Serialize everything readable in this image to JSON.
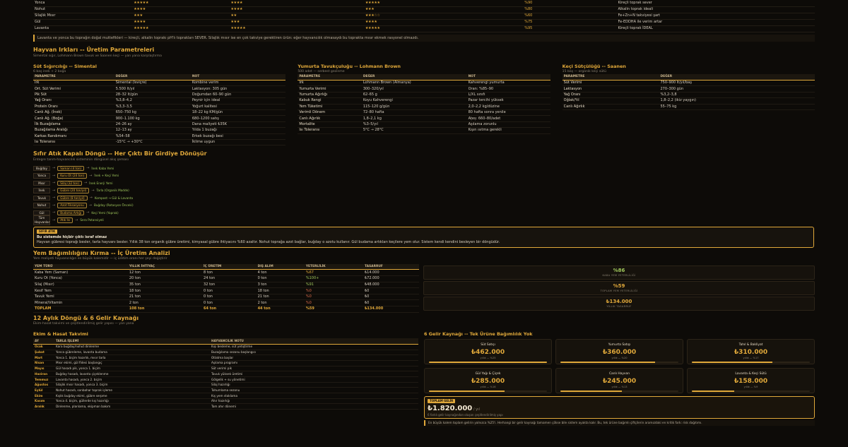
{
  "soil_rows": [
    {
      "name": "Yonca",
      "s1": "★★★★★",
      "s2": "★★★★",
      "s3": "★★★★★",
      "pct": "%90",
      "note": "Kireçli toprak sever"
    },
    {
      "name": "Nohut",
      "s1": "★★★★",
      "s2": "★★★★",
      "s3": "★★★",
      "pct": "%80",
      "note": "Alkalin toprak ideali"
    },
    {
      "name": "Silajlık Mısır",
      "s1": "★★★",
      "s2": "★★",
      "s3": "★★★☆☆",
      "pct": "%60",
      "note": "Fe+Zn+N takviyesi şart"
    },
    {
      "name": "Gül",
      "s1": "★★★★",
      "s2": "★★★",
      "s3": "★★★★",
      "pct": "%75",
      "note": "Fe-EDDHA ile verim artar"
    },
    {
      "name": "Lavanta",
      "s1": "★★★★★",
      "s2": "★★★★★",
      "s3": "★★★★★",
      "pct": "%95",
      "note": "Kireçli toprak İDEAL"
    }
  ],
  "soil_note": "Lavanta ve yonca bu toprağın doğal muttefikleri — kireçli, alkalin toprakı pH'lı toprakları SEVER. Silajlık mısır ise en çok takviye gerektiren ürün: eğer hayvancılık olmasaydı bu toprakta mısır ekmek rasyonel olmazdı.",
  "livestock": {
    "title": "Hayvan Irkları -- Üretim Parametreleri",
    "subtitle": "Simental sığır, Lohmann Brown tavuk ve Saanen keçi — yan yana karşılaştırma",
    "headers": {
      "param": "PARAMETRE",
      "value": "DEĞER",
      "note": "NOT"
    },
    "dairy": {
      "title": "Süt Sığırcılığı -- Simental",
      "sub": "6 baş inek + 2 boğa",
      "rows": [
        [
          "Irk",
          "Simental (İsviçre)",
          "Kombine verim"
        ],
        [
          "Ort. Süt Verimi",
          "5.500 lt/yıl",
          "Laktasyon: 305 gün"
        ],
        [
          "Pik Süt",
          "28–32 lt/gün",
          "Doğumdan 60–90 gün"
        ],
        [
          "Yağ Oranı",
          "%3,8–4,2",
          "Peynir için ideal"
        ],
        [
          "Protein Oranı",
          "%3,3–3,5",
          "Yoğurt kalitesi"
        ],
        [
          "Canlı Ağ. (İnek)",
          "650–750 kg",
          "18–22 kg KM/gün"
        ],
        [
          "Canlı Ağ. (Boğa)",
          "900–1.100 kg",
          "680–1200 satış"
        ],
        [
          "İlk Buzağılama",
          "24–26 ay",
          "Dana maliyeti ₺35K"
        ],
        [
          "Buzağılama Aralığı",
          "12–13 ay",
          "Yılda 1 buzağı"
        ],
        [
          "Karkas Randımanı",
          "%54–58",
          "Erkek buzağı besi"
        ],
        [
          "Isı Toleransı",
          "-15°C → +30°C",
          "İklime uygun"
        ]
      ]
    },
    "poultry": {
      "title": "Yumurta Tavukçuluğu -- Lohmann Brown",
      "sub": "500 adet — serbest gezinme",
      "rows": [
        [
          "Irk",
          "Lohmann Brown (Almanya)",
          "Kahverengi yumurta"
        ],
        [
          "Yumurta Verimi",
          "300–320/yıl",
          "Oran: %85–90"
        ],
        [
          "Yumurta Ağırlığı",
          "62–65 g",
          "L/XL sınıfı"
        ],
        [
          "Kabuk Rengi",
          "Koyu Kahverengi",
          "Pazar tercihi yüksek"
        ],
        [
          "Yem Tüketimi",
          "115–120 g/gün",
          "2,0–2,2 kg/düzine"
        ],
        [
          "Verimli Dönem",
          "72–80 hafta",
          "80 hafta sonra yenile"
        ],
        [
          "Canlı Ağırlık",
          "1,8–2,1 kg",
          "Ațeș: 660–80/adet"
        ],
        [
          "Mortalite",
          "%3–5/yıl",
          "Aşılama zorunlu"
        ],
        [
          "Isı Toleransı",
          "5°C → 28°C",
          "Kışın ısıtma gerekli"
        ]
      ]
    },
    "goat": {
      "title": "Keçi Sütçülüğü -- Saanen",
      "sub": "15 baş — organik keçi sütü",
      "rows": [
        [
          "Süt Verimi",
          "750–900 lt/yıl/baş"
        ],
        [
          "Laktasyon",
          "270–300 gün"
        ],
        [
          "Yağ Oranı",
          "%3,2–3,8"
        ],
        [
          "Oğlak/Yıl",
          "1,8–2,2 (ikiz yaygın)"
        ],
        [
          "Canlı Ağırlık",
          "55–75 kg"
        ]
      ]
    }
  },
  "cycle": {
    "title": "Sıfır Atık Kapalı Döngü -- Her Çıktı Bir Girdiye Dönüşür",
    "subtitle": "Entegre tarım-hayvancılık sisteminin döngüsel akış şeması",
    "rows": [
      [
        "Buğday",
        "Saman (4 ton)",
        "İnek Kaba Yemi"
      ],
      [
        "Yonca",
        "Kuru Ot (24 ton)",
        "İnek + Keçi Yemi"
      ],
      [
        "Mısır",
        "Silaj (32 ton)",
        "İnek Enerji Yemi"
      ],
      [
        "İnek",
        "Gübre (20 ton/yıl)",
        "Tarla (Organik Madde)"
      ],
      [
        "Tavuk",
        "Gübre (8 ton/yıl)",
        "Kompost → Gül & Lavanta"
      ],
      [
        "Nohut",
        "Azot Fiksasyonu",
        "Buğday (Rotasyon Önceki)"
      ],
      [
        "Gül",
        "Budama Artığı",
        "Keçi Yemi (Yaprak)"
      ],
      [
        "Tüm Hayvanlar",
        "Atık Isı",
        "Sera Potansiyeli"
      ]
    ],
    "tag": "SIFIR ATIK",
    "zero_title": "Bu sistemde hiçbir çıktı israf olmaz",
    "zero_text": "Hayvan gübresi toprağı besler, tarla hayvanı besler. Yıllık 38 ton organik gübre üretimi, kimyasal gübre ihtiyacını %60 azaltır. Nohut toprağa azot bağlar, buğday o azotu kullanır. Gül budama artıkları keçilere yem olur. Sistem kendi kendini besleyen bir döngüdür."
  },
  "feed": {
    "title": "Yem Bağımlılığını Kırma -- İç Üretim Analizi",
    "subtitle": "Yem maliyeti hayvancılığın en büyük kalemidir — iç üretim oranı her şeyi değiştirir",
    "headers": [
      "YEM TÜRÜ",
      "YILLIK İHTİYAÇ",
      "İÇ ÜRETİM",
      "DIŞ ALIM",
      "YETERLİLİK",
      "TASARRUF"
    ],
    "rows": [
      {
        "c": [
          "Kaba Yem (Saman)",
          "12 ton",
          "8 ton",
          "4 ton",
          "%67",
          "₺14.000"
        ],
        "k": "mid"
      },
      {
        "c": [
          "Kuru Ot (Yonca)",
          "20 ton",
          "24 ton",
          "0 ton",
          "%100+",
          "₺72.000"
        ],
        "k": "good"
      },
      {
        "c": [
          "Silaj (Mısır)",
          "35 ton",
          "32 ton",
          "3 ton",
          "%91",
          "₺48.000"
        ],
        "k": "good"
      },
      {
        "c": [
          "Kesif Yem",
          "18 ton",
          "0 ton",
          "18 ton",
          "%0",
          "₺0"
        ],
        "k": "bad"
      },
      {
        "c": [
          "Tavuk Yemi",
          "21 ton",
          "0 ton",
          "21 ton",
          "%0",
          "₺0"
        ],
        "k": "bad"
      },
      {
        "c": [
          "Mineral/Vitamin",
          "2 ton",
          "0 ton",
          "2 ton",
          "%0",
          "₺0"
        ],
        "k": "bad"
      }
    ],
    "total": [
      "TOPLAM",
      "108 ton",
      "64 ton",
      "44 ton",
      "%59",
      "₺134.000"
    ],
    "kpis": [
      {
        "v": "%86",
        "l": "KABA YEM YETERLİLİĞİ",
        "c": "#9fc65c"
      },
      {
        "v": "%59",
        "l": "TOPLAM YEM YETERLİLİĞİ",
        "c": "#e0a83a"
      },
      {
        "v": "₺134.000",
        "l": "YILLIK TASARRUF",
        "c": "#e0a83a"
      }
    ]
  },
  "cycle12": {
    "title": "12 Aylık Döngü & 6 Gelir Kaynağı",
    "subtitle": "Ekim-hasat takvimi ve çeşitlendirilmiş gelir yapısı — yan yana",
    "cal_title": "Ekim & Hasat Takvimi",
    "cal_headers": [
      "AY",
      "TARLA İŞLEMİ",
      "HAYVANCILIK NOTU"
    ],
    "cal_rows": [
      [
        "Ocak",
        "Kara buğday/nohut dinlenme",
        "Kışı besleme, süt yetiştirme"
      ],
      [
        "Şubat",
        "Yonca gübreleme, lavanta budama",
        "Buzağılama sezonu başlangıcı"
      ],
      [
        "Mart",
        "Yonca 1. biçim hazırlık, mısır tarla",
        "Otlatma başlar"
      ],
      [
        "Nisan",
        "Mısır ekimi, gül fidesi başlangıç",
        "Aşılama programı"
      ],
      [
        "Mayıs",
        "Gül hasadı pik, yonca 1. biçim",
        "Süt verimi pik"
      ],
      [
        "Haziran",
        "Buğday hasadı, lavanta çiçeklenme",
        "Tavuk yüksek üretimi"
      ],
      [
        "Temmuz",
        "Lavanta hasadı, yonca 2. biçim",
        "Gölgelik + su yönetimi"
      ],
      [
        "Ağustos",
        "Silajlık mısır hasadı, yonca 3. biçim",
        "Silaj hazırlığı"
      ],
      [
        "Eylül",
        "Nohut hasadı, sonbahar toprak işleme",
        "Tohumlama sezonu"
      ],
      [
        "Ekim",
        "Kışlık buğday ekimi, gübre serpme",
        "Kış yem stoklama"
      ],
      [
        "Kasım",
        "Yonca 4. biçim, güllerde kış hazırlığı",
        "Ahır hazırlığı"
      ],
      [
        "Aralık",
        "Dinlenme, planlama, ekipman bakım",
        "Tam ahır dönemi"
      ]
    ],
    "income_title": "6 Gelir Kaynağı -- Tek Ürüne Bağımlılık Yok",
    "cards": [
      {
        "n": "Süt Satışı",
        "v": "₺462.000",
        "s": "yıllık — %25",
        "p": 25
      },
      {
        "n": "Yumurta Satışı",
        "v": "₺360.000",
        "s": "yıllık — %20",
        "p": 20
      },
      {
        "n": "Tahıl & Bakliyat",
        "v": "₺310.000",
        "s": "yıllık — %17",
        "p": 17
      },
      {
        "n": "Gül Yağı & Çiçek",
        "v": "₺285.000",
        "s": "yıllık — %16",
        "p": 16
      },
      {
        "n": "Canlı Hayvan",
        "v": "₺245.000",
        "s": "yıllık — %13",
        "p": 13
      },
      {
        "n": "Lavanta & Keçi Sütü",
        "v": "₺158.000",
        "s": "yıllık — %9",
        "p": 9
      }
    ],
    "total_tag": "TOPLAM GELİR",
    "total_value": "₺1.820.000",
    "total_unit": "/ yıl",
    "total_sub": "6 farklı gelir kaynağından oluşan çeşitlendirilmiş yapı",
    "foot": "En büyük kalem toplam gelirin yalnızca %25'i. Herhangi bir gelir kaynağı tamamen çökse bile sistem ayakta kalır. Bu, tek ürüne bağımlı çiftçilerin aramızdaki en kritik fark: risk dağıtımı."
  }
}
